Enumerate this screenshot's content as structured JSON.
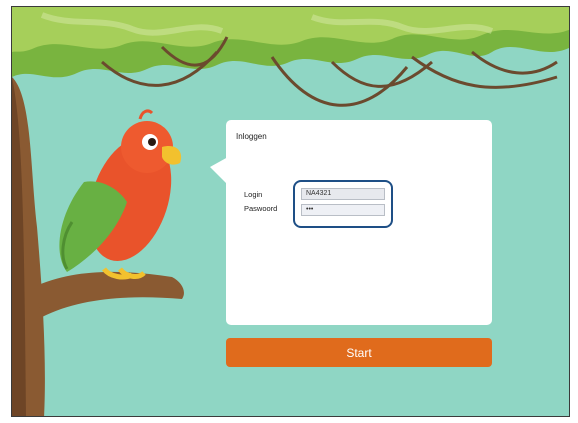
{
  "login_card": {
    "title": "Inloggen",
    "login_label": "Login",
    "login_value": "NA4321",
    "password_label": "Paswoord",
    "password_value": "•••"
  },
  "start_button": {
    "label": "Start"
  },
  "colors": {
    "background": "#8fd6c4",
    "accent_button": "#e06b1c",
    "focus_outline": "#1e4f86"
  }
}
